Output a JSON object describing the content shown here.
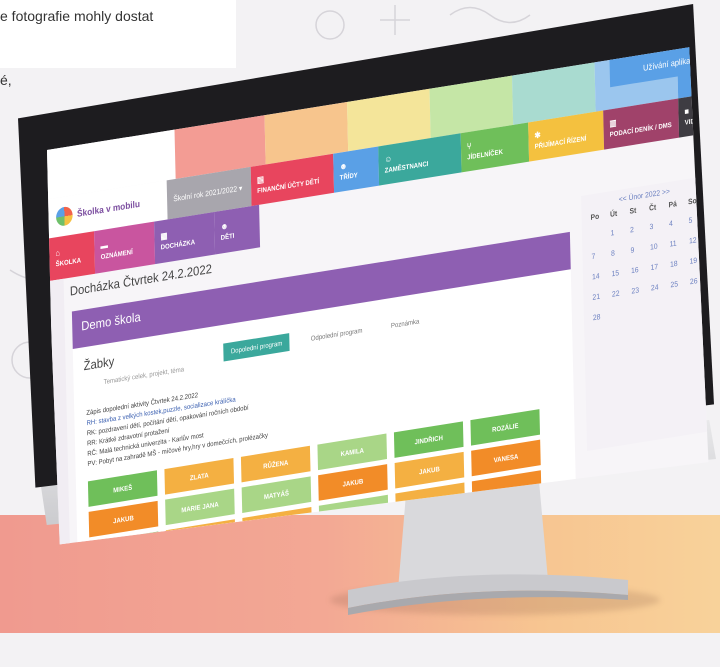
{
  "caption": {
    "line1": "e fotografie mohly dostat",
    "line2": "é,"
  },
  "app": {
    "logo_text": "Školka v mobilu",
    "school_year": "Školní rok 2021/2022",
    "utility_menu": "Užívání aplikace",
    "top_colors": [
      "#ffffff",
      "#f39c94",
      "#f7c58d",
      "#f4e59a",
      "#c5e6a6",
      "#a9dbd0",
      "#9bc6ee",
      "#5aa0e6"
    ],
    "nav_top": [
      {
        "label": "FINANČNÍ ÚČTY DĚTÍ",
        "icon": "wallet-icon",
        "color": "#e8455e"
      },
      {
        "label": "TŘÍDY",
        "icon": "users-icon",
        "color": "#5aa0e6"
      },
      {
        "label": "ZAMĚSTNANCI",
        "icon": "smile-icon",
        "color": "#3ba89c"
      },
      {
        "label": "JÍDELNÍČEK",
        "icon": "fork-knife-icon",
        "color": "#6fbf5a"
      },
      {
        "label": "PŘIJÍMACÍ ŘÍZENÍ",
        "icon": "star-icon",
        "color": "#f4c13f"
      },
      {
        "label": "PODACÍ DENÍK / DMS",
        "icon": "document-icon",
        "color": "#a0426a"
      },
      {
        "label": "VIDEO NÁVODY",
        "icon": "video-icon",
        "color": "#3e3c42"
      }
    ],
    "nav_main": [
      {
        "label": "ŠKOLKA",
        "icon": "home-icon",
        "color": "#e8455e"
      },
      {
        "label": "OZNÁMENÍ",
        "icon": "message-icon",
        "color": "#c9559f"
      },
      {
        "label": "DOCHÁZKA",
        "icon": "calendar-icon",
        "color": "#8e5fb2"
      },
      {
        "label": "DĚTI",
        "icon": "children-icon",
        "color": "#8e5fb2"
      }
    ],
    "page_title": "Docházka Čtvrtek 24.2.2022",
    "panel_title": "Demo škola",
    "group_name": "Žabky",
    "subtitle": "Tematický celek, projekt, téma",
    "tabs": [
      "Dopolední program",
      "Odpolední program",
      "Poznámka"
    ],
    "notes": {
      "heading": "Zápis dopolední aktivity Čtvrtek 24.2.2022",
      "lines": [
        "RH: stavba z velkých kostek,puzzle, socializace králíčka",
        "RK: pozdravení dětí, počítání dětí, opakování ročních období",
        "RR: Krátké zdravotní protažení",
        "RČ: Malá technická univerzita - Karlův most",
        "PV: Pobyt na zahradě MŠ - míčové hry,hry v domečcích, prolézačky"
      ]
    },
    "children": [
      {
        "name": "MIKEŠ",
        "color": "#6fbf5a"
      },
      {
        "name": "ZLATA",
        "color": "#f4b042"
      },
      {
        "name": "RŮŽENA",
        "color": "#f4b042"
      },
      {
        "name": "KAMILA",
        "color": "#a9d687"
      },
      {
        "name": "JINDŘICH",
        "color": "#6fbf5a"
      },
      {
        "name": "ROZÁLIE",
        "color": "#6fbf5a"
      },
      {
        "name": "JAKUB",
        "color": "#f28c28"
      },
      {
        "name": "MARIE JANA",
        "color": "#a9d687"
      },
      {
        "name": "MATYÁŠ",
        "color": "#a9d687"
      },
      {
        "name": "JAKUB",
        "color": "#f28c28"
      },
      {
        "name": "JAKUB",
        "color": "#f4b042"
      },
      {
        "name": "VANESA",
        "color": "#f28c28"
      },
      {
        "name": "",
        "color": "#6fbf5a"
      },
      {
        "name": "",
        "color": "#f4b042"
      },
      {
        "name": "",
        "color": "#f4b042"
      },
      {
        "name": "",
        "color": "#a9d687"
      },
      {
        "name": "",
        "color": "#f4b042"
      },
      {
        "name": "",
        "color": "#f28c28"
      }
    ],
    "calendar": {
      "header": "<< Únor 2022 >>",
      "weekdays": [
        "Po",
        "Út",
        "St",
        "Čt",
        "Pá",
        "So",
        "Ne"
      ],
      "days": [
        "",
        "1",
        "2",
        "3",
        "4",
        "5",
        "6",
        "7",
        "8",
        "9",
        "10",
        "11",
        "12",
        "13",
        "14",
        "15",
        "16",
        "17",
        "18",
        "19",
        "20",
        "21",
        "22",
        "23",
        "24",
        "25",
        "26",
        "27",
        "28"
      ]
    }
  }
}
